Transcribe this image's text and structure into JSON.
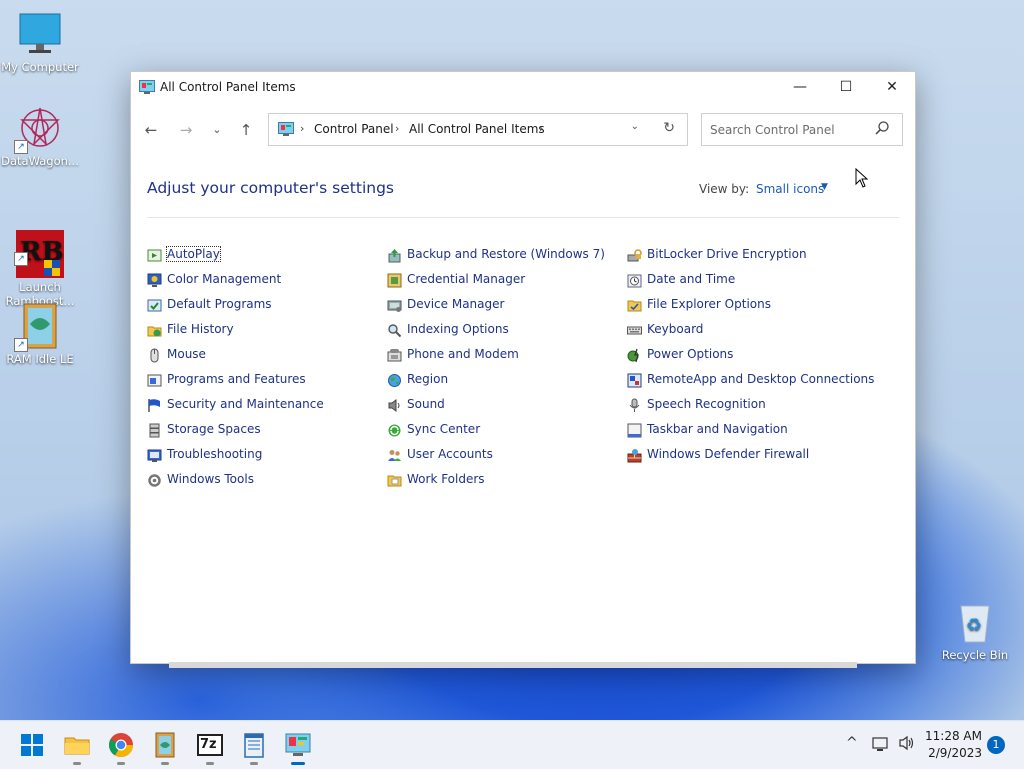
{
  "desktop": {
    "icons": [
      {
        "label": "My Computer"
      },
      {
        "label": "DataWagon..."
      },
      {
        "label": "Launch\nRamboost..."
      },
      {
        "label": "RAM Idle LE"
      },
      {
        "label": "Recycle Bin"
      }
    ]
  },
  "window": {
    "title": "All Control Panel Items",
    "minimize": "—",
    "maximize": "☐",
    "close": "✕"
  },
  "nav": {
    "back": "←",
    "forward": "→",
    "recent": "⌄",
    "up": "↑",
    "breadcrumb": [
      "Control Panel",
      "All Control Panel Items"
    ],
    "separator": "›",
    "search_placeholder": "Search Control Panel"
  },
  "content": {
    "heading": "Adjust your computer's settings",
    "view_by_label": "View by:",
    "view_by_value": "Small icons",
    "columns": [
      [
        {
          "label": "AutoPlay",
          "icon": "autoplay-icon"
        },
        {
          "label": "Color Management",
          "icon": "color-management-icon"
        },
        {
          "label": "Default Programs",
          "icon": "default-programs-icon"
        },
        {
          "label": "File History",
          "icon": "file-history-icon"
        },
        {
          "label": "Mouse",
          "icon": "mouse-icon"
        },
        {
          "label": "Programs and Features",
          "icon": "programs-features-icon"
        },
        {
          "label": "Security and Maintenance",
          "icon": "flag-icon"
        },
        {
          "label": "Storage Spaces",
          "icon": "storage-icon"
        },
        {
          "label": "Troubleshooting",
          "icon": "troubleshooting-icon"
        },
        {
          "label": "Windows Tools",
          "icon": "windows-tools-icon"
        }
      ],
      [
        {
          "label": "Backup and Restore (Windows 7)",
          "icon": "backup-icon"
        },
        {
          "label": "Credential Manager",
          "icon": "credential-icon"
        },
        {
          "label": "Device Manager",
          "icon": "device-manager-icon"
        },
        {
          "label": "Indexing Options",
          "icon": "indexing-icon"
        },
        {
          "label": "Phone and Modem",
          "icon": "phone-icon"
        },
        {
          "label": "Region",
          "icon": "globe-icon"
        },
        {
          "label": "Sound",
          "icon": "speaker-icon"
        },
        {
          "label": "Sync Center",
          "icon": "sync-icon"
        },
        {
          "label": "User Accounts",
          "icon": "users-icon"
        },
        {
          "label": "Work Folders",
          "icon": "work-folders-icon"
        }
      ],
      [
        {
          "label": "BitLocker Drive Encryption",
          "icon": "bitlocker-icon"
        },
        {
          "label": "Date and Time",
          "icon": "clock-icon"
        },
        {
          "label": "File Explorer Options",
          "icon": "folder-options-icon"
        },
        {
          "label": "Keyboard",
          "icon": "keyboard-icon"
        },
        {
          "label": "Power Options",
          "icon": "power-icon"
        },
        {
          "label": "RemoteApp and Desktop Connections",
          "icon": "remoteapp-icon"
        },
        {
          "label": "Speech Recognition",
          "icon": "microphone-icon"
        },
        {
          "label": "Taskbar and Navigation",
          "icon": "taskbar-icon"
        },
        {
          "label": "Windows Defender Firewall",
          "icon": "firewall-icon"
        }
      ]
    ]
  },
  "taskbar": {
    "apps": [
      "start-icon",
      "file-explorer-icon",
      "chrome-icon",
      "ram-idle-icon",
      "7zip-icon",
      "notepad-icon",
      "control-panel-icon"
    ],
    "tray_chevron": "^",
    "time": "11:28 AM",
    "date": "2/9/2023",
    "notification_count": "1",
    "sevenzip_label": "7z"
  },
  "colors": {
    "link": "#1e3287",
    "accent": "#0067c0"
  }
}
